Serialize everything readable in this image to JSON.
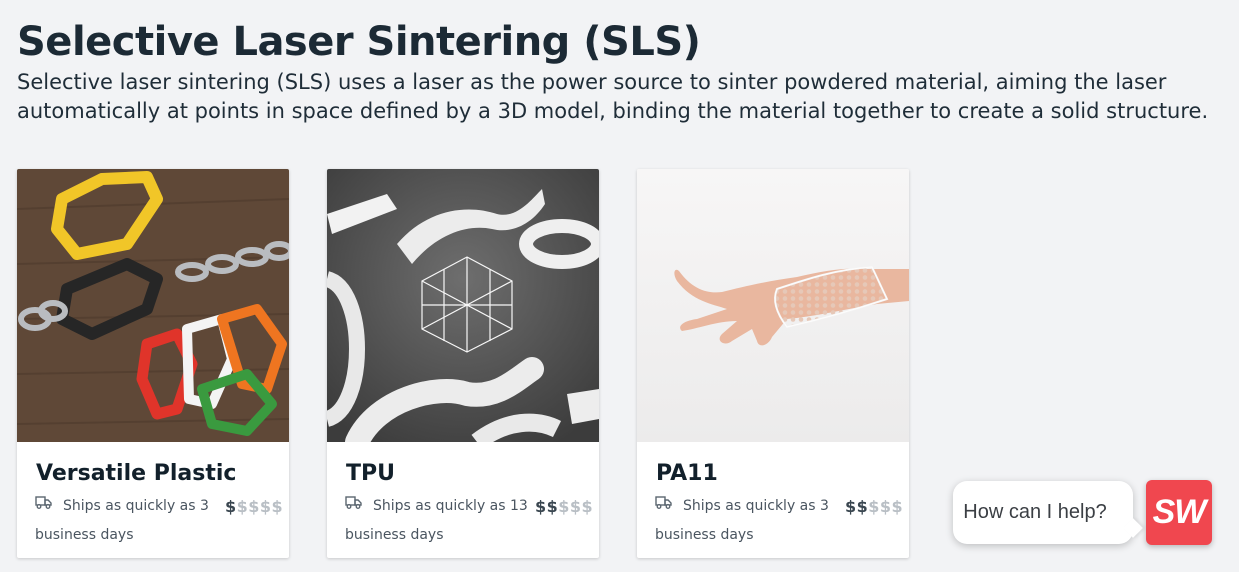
{
  "page": {
    "title": "Selective Laser Sintering (SLS)",
    "intro": "Selective laser sintering (SLS) uses a laser as the power source to sinter powdered material, aiming the laser automatically at points in space defined by a 3D model, binding the material together to create a solid structure."
  },
  "materials": [
    {
      "name": "Versatile Plastic",
      "ships_prefix": "Ships as quickly as 3",
      "ships_suffix": "business days",
      "price_on": "$",
      "price_off": "$$$$"
    },
    {
      "name": "TPU",
      "ships_prefix": "Ships as quickly as 13",
      "ships_suffix": "business days",
      "price_on": "$$",
      "price_off": "$$$"
    },
    {
      "name": "PA11",
      "ships_prefix": "Ships as quickly as 3",
      "ships_suffix": "business days",
      "price_on": "$$",
      "price_off": "$$$"
    }
  ],
  "chat": {
    "prompt": "How can I help?",
    "logo": "SW"
  },
  "icons": {
    "shipping": "truck-icon"
  },
  "colors": {
    "accent": "#f0474f",
    "price_active": "#3a4650",
    "price_inactive": "#b9bfc5"
  }
}
